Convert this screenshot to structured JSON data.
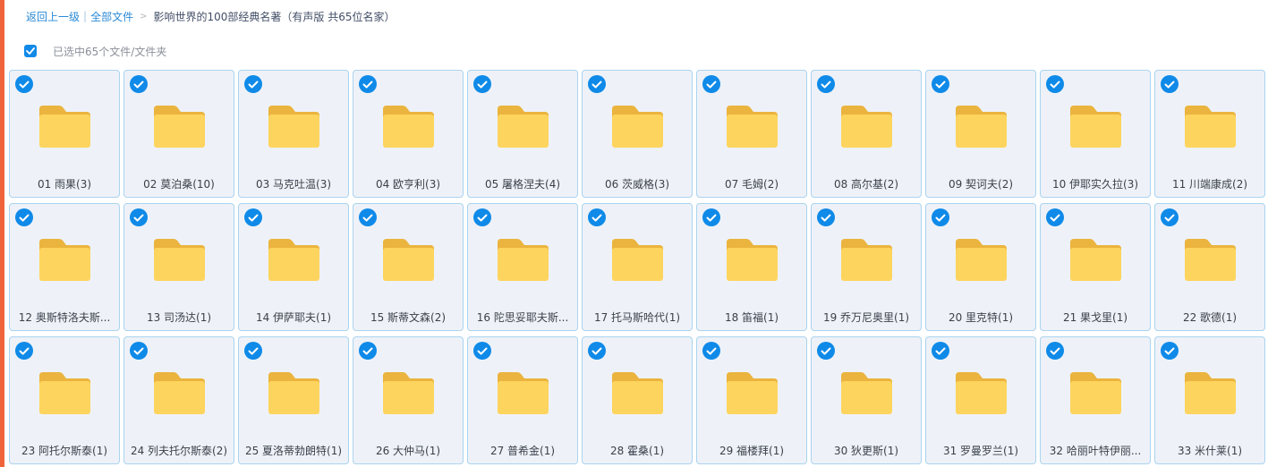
{
  "breadcrumb": {
    "back_label": "返回上一级",
    "all_files_label": "全部文件",
    "separator_bar": "|",
    "separator_gt": ">",
    "current_folder": "影响世界的100部经典名著（有声版 共65位名家）"
  },
  "selection": {
    "status_text": "已选中65个文件/文件夹",
    "all_selected": true
  },
  "colors": {
    "accent": "#0f8ae8",
    "link": "#2a8ad6",
    "folder_body": "#fdd45e",
    "folder_tab": "#ebb43e",
    "tile_border": "#a9d3f0",
    "tile_bg": "#eef2f8",
    "left_accent": "#f0643c"
  },
  "icons": {
    "tile_check": "check-circle-icon",
    "folder": "folder-icon",
    "select_all": "checkbox-checked-icon"
  },
  "folders": [
    {
      "name": "01 雨果(3)"
    },
    {
      "name": "02 莫泊桑(10)"
    },
    {
      "name": "03 马克吐温(3)"
    },
    {
      "name": "04 欧亨利(3)"
    },
    {
      "name": "05 屠格涅夫(4)"
    },
    {
      "name": "06 茨威格(3)"
    },
    {
      "name": "07 毛姆(2)"
    },
    {
      "name": "08 高尔基(2)"
    },
    {
      "name": "09 契诃夫(2)"
    },
    {
      "name": "10 伊耶实久拉(3)"
    },
    {
      "name": "11 川端康成(2)"
    },
    {
      "name": "12 奥斯特洛夫斯..."
    },
    {
      "name": "13 司汤达(1)"
    },
    {
      "name": "14 伊萨耶夫(1)"
    },
    {
      "name": "15 斯蒂文森(2)"
    },
    {
      "name": "16 陀思妥耶夫斯..."
    },
    {
      "name": "17 托马斯哈代(1)"
    },
    {
      "name": "18 笛福(1)"
    },
    {
      "name": "19 乔万尼奥里(1)"
    },
    {
      "name": "20 里克特(1)"
    },
    {
      "name": "21 果戈里(1)"
    },
    {
      "name": "22 歌德(1)"
    },
    {
      "name": "23 阿托尔斯泰(1)"
    },
    {
      "name": "24 列夫托尔斯泰(2)"
    },
    {
      "name": "25 夏洛蒂勃朗特(1)"
    },
    {
      "name": "26 大仲马(1)"
    },
    {
      "name": "27 普希金(1)"
    },
    {
      "name": "28 霍桑(1)"
    },
    {
      "name": "29 福楼拜(1)"
    },
    {
      "name": "30 狄更斯(1)"
    },
    {
      "name": "31 罗曼罗兰(1)"
    },
    {
      "name": "32 哈丽叶特伊丽..."
    },
    {
      "name": "33 米什莱(1)"
    }
  ]
}
